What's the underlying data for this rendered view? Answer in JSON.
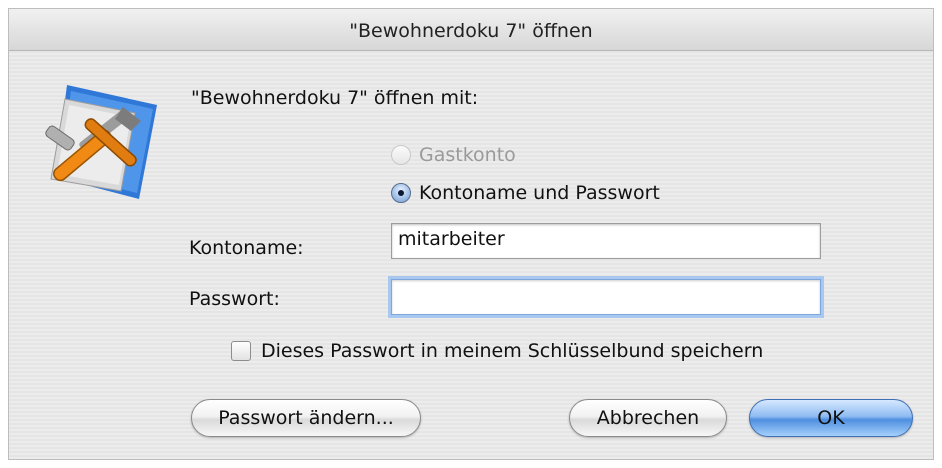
{
  "window": {
    "title": "\"Bewohnerdoku 7\" öffnen"
  },
  "dialog": {
    "prompt": "\"Bewohnerdoku 7\" öffnen mit:",
    "radio_guest": "Gastkonto",
    "radio_account": "Kontoname und Passwort",
    "account_label": "Kontoname:",
    "account_value": "mitarbeiter",
    "password_label": "Passwort:",
    "password_value": "",
    "keychain_label": "Dieses Passwort in meinem Schlüsselbund speichern",
    "keychain_checked": false,
    "selected_option": "Kontoname und Passwort"
  },
  "buttons": {
    "change_password": "Passwort ändern...",
    "cancel": "Abbrechen",
    "ok": "OK"
  },
  "icons": {
    "app": "filemaker-tools-icon"
  },
  "colors": {
    "default_button": "#5d9be8",
    "focus_ring": "#a9c8ef"
  }
}
